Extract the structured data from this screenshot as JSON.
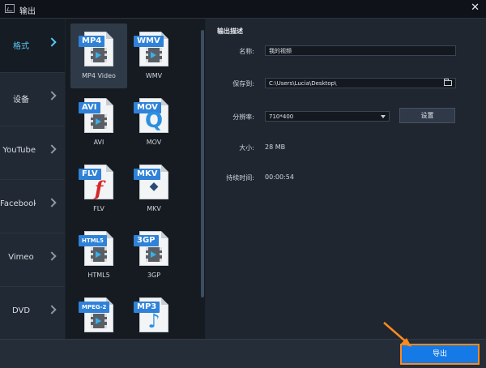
{
  "window": {
    "title": "输出",
    "close_glyph": "✕"
  },
  "sidebar": {
    "items": [
      {
        "label": "格式",
        "active": true
      },
      {
        "label": "设备",
        "active": false
      },
      {
        "label": "YouTube",
        "active": false
      },
      {
        "label": "Facebook",
        "active": false
      },
      {
        "label": "Vimeo",
        "active": false
      },
      {
        "label": "DVD",
        "active": false
      }
    ]
  },
  "formats": [
    {
      "badge": "MP4",
      "label": "MP4 Video",
      "icon": "video-file-icon",
      "active": true
    },
    {
      "badge": "WMV",
      "label": "WMV",
      "icon": "video-file-icon",
      "active": false
    },
    {
      "badge": "AVI",
      "label": "AVI",
      "icon": "video-file-icon",
      "active": false
    },
    {
      "badge": "MOV",
      "label": "MOV",
      "icon": "quicktime-file-icon",
      "active": false
    },
    {
      "badge": "FLV",
      "label": "FLV",
      "icon": "flash-file-icon",
      "active": false
    },
    {
      "badge": "MKV",
      "label": "MKV",
      "icon": "matroska-file-icon",
      "active": false
    },
    {
      "badge": "HTML5",
      "label": "HTML5",
      "icon": "video-file-icon",
      "active": false
    },
    {
      "badge": "3GP",
      "label": "3GP",
      "icon": "video-file-icon",
      "active": false
    },
    {
      "badge": "MPEG-2",
      "label": "",
      "icon": "video-file-icon",
      "active": false
    },
    {
      "badge": "MP3",
      "label": "",
      "icon": "audio-file-icon",
      "active": false
    }
  ],
  "output": {
    "section_title": "输出描述",
    "name_label": "名称:",
    "name_value": "我的视频",
    "save_label": "保存到:",
    "save_path": "C:\\Users\\Lucia\\Desktop\\",
    "resolution_label": "分辨率:",
    "resolution_value": "710*400",
    "settings_button": "设置",
    "size_label": "大小:",
    "size_value": "28 MB",
    "duration_label": "持续时间:",
    "duration_value": "00:00:54"
  },
  "footer": {
    "export_button": "导出"
  },
  "colors": {
    "accent": "#1579e6",
    "highlight": "#ff8a1c",
    "active_text": "#59c8f0"
  }
}
